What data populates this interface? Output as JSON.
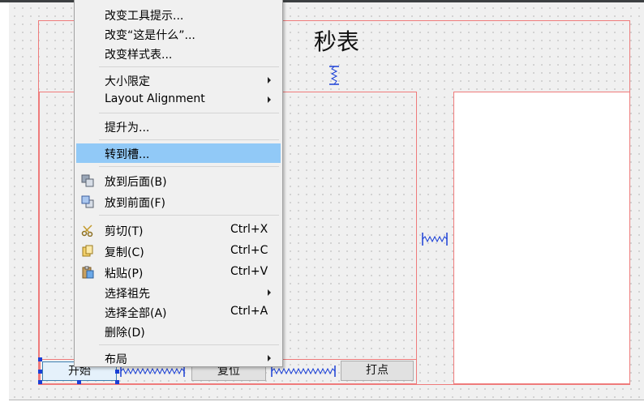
{
  "form": {
    "title": "秒表",
    "buttons": {
      "start": "开始",
      "reset": "复位",
      "lap": "打点"
    }
  },
  "context_menu": {
    "items": [
      {
        "label": "改变工具提示..."
      },
      {
        "label": "改变“这是什么”..."
      },
      {
        "label": "改变样式表..."
      },
      {
        "label": "大小限定",
        "submenu": true
      },
      {
        "label": "Layout Alignment",
        "submenu": true
      },
      {
        "label": "提升为..."
      },
      {
        "label": "转到槽...",
        "highlighted": true
      },
      {
        "label": "放到后面(B)",
        "icon": "send-to-back-icon"
      },
      {
        "label": "放到前面(F)",
        "icon": "bring-to-front-icon"
      },
      {
        "label": "剪切(T)",
        "shortcut": "Ctrl+X",
        "icon": "scissors-icon"
      },
      {
        "label": "复制(C)",
        "shortcut": "Ctrl+C",
        "icon": "copy-icon"
      },
      {
        "label": "粘贴(P)",
        "shortcut": "Ctrl+V",
        "icon": "paste-icon"
      },
      {
        "label": "选择祖先",
        "submenu": true
      },
      {
        "label": "选择全部(A)",
        "shortcut": "Ctrl+A"
      },
      {
        "label": "删除(D)"
      },
      {
        "label": "布局",
        "submenu": true
      }
    ]
  },
  "colors": {
    "layout_border": "#ef7b7b",
    "menu_highlight": "#91c9f7",
    "selection_handle": "#1a3fd6",
    "spacer": "#1a3fd6"
  }
}
